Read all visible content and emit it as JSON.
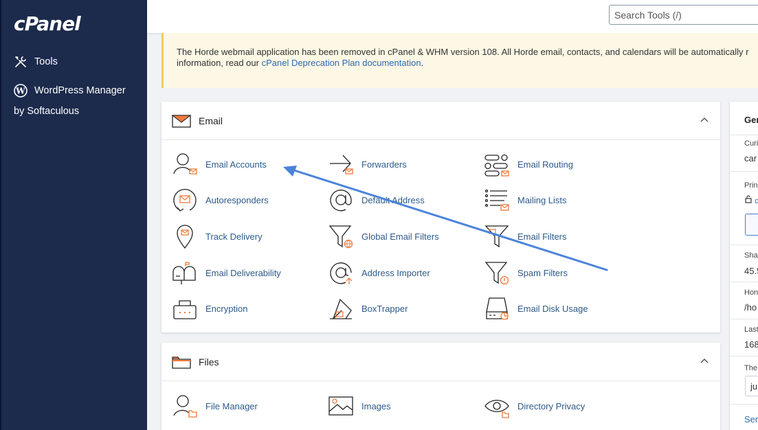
{
  "sidebar": {
    "logo": "cPanel",
    "items": [
      {
        "label": "Tools",
        "icon": "tools-icon"
      },
      {
        "label": "WordPress Manager",
        "label2": "by Softaculous",
        "icon": "wordpress-icon"
      }
    ]
  },
  "header": {
    "search_placeholder": "Search Tools (/)"
  },
  "notice": {
    "line1": "The Horde webmail application has been removed in cPanel & WHM version 108. All Horde email, contacts, and calendars will be automatically r",
    "line2_prefix": "information, read our ",
    "link": "cPanel Deprecation Plan documentation",
    "line2_suffix": "."
  },
  "email_section": {
    "title": "Email",
    "tools": [
      {
        "label": "Email Accounts",
        "icon": "email-accounts-icon"
      },
      {
        "label": "Forwarders",
        "icon": "forwarders-icon"
      },
      {
        "label": "Email Routing",
        "icon": "email-routing-icon"
      },
      {
        "label": "Autoresponders",
        "icon": "autoresponders-icon"
      },
      {
        "label": "Default Address",
        "icon": "default-address-icon"
      },
      {
        "label": "Mailing Lists",
        "icon": "mailing-lists-icon"
      },
      {
        "label": "Track Delivery",
        "icon": "track-delivery-icon"
      },
      {
        "label": "Global Email Filters",
        "icon": "global-email-filters-icon"
      },
      {
        "label": "Email Filters",
        "icon": "email-filters-icon"
      },
      {
        "label": "Email Deliverability",
        "icon": "email-deliverability-icon"
      },
      {
        "label": "Address Importer",
        "icon": "address-importer-icon"
      },
      {
        "label": "Spam Filters",
        "icon": "spam-filters-icon"
      },
      {
        "label": "Encryption",
        "icon": "encryption-icon"
      },
      {
        "label": "BoxTrapper",
        "icon": "boxtrapper-icon"
      },
      {
        "label": "Email Disk Usage",
        "icon": "email-disk-usage-icon"
      }
    ]
  },
  "files_section": {
    "title": "Files",
    "tools": [
      {
        "label": "File Manager",
        "icon": "file-manager-icon"
      },
      {
        "label": "Images",
        "icon": "images-icon"
      },
      {
        "label": "Directory Privacy",
        "icon": "directory-privacy-icon"
      }
    ]
  },
  "right_panel": {
    "heading": "Ger",
    "cur_label": "Curi",
    "cur_value": "car",
    "prim_label": "Prin",
    "prim_link": "c",
    "shared_label": "Sha",
    "shared_value": "45.5",
    "home_label": "Hon",
    "home_value": "/ho",
    "last_label": "Last",
    "last_value": "168",
    "theme_label": "The",
    "theme_value": "ju",
    "server_link": "Ser"
  },
  "colors": {
    "sidebar_bg": "#1c2a4c",
    "accent_orange": "#f07a3a",
    "link_blue": "#2d5a8a",
    "arrow_blue": "#4a84db",
    "notice_bg": "#fdf7e5"
  }
}
